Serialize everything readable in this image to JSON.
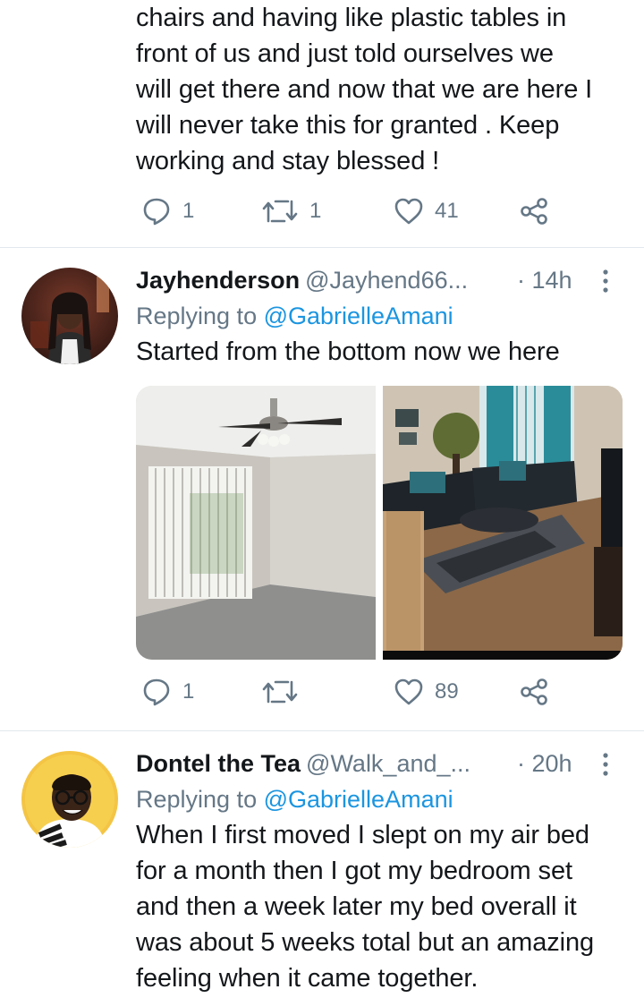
{
  "top_tweet": {
    "text_lines": [
      "chairs and having like plastic tables in",
      "front of us and just told ourselves we",
      "will get there and now that we are here I",
      "will never take this for granted . Keep",
      "working and stay blessed !"
    ],
    "replies": "1",
    "retweets": "1",
    "likes": "41"
  },
  "reply1": {
    "name": "Jayhenderson",
    "handle": "@Jayhend66...",
    "time": "· 14h",
    "replying_prefix": "Replying to",
    "replying_to": "@GabrielleAmani",
    "text": "Started from the bottom now we here",
    "replies": "1",
    "retweets": "",
    "likes": "89"
  },
  "reply2": {
    "name": "Dontel the Tea",
    "handle": "@Walk_and_...",
    "time": "· 20h",
    "replying_prefix": "Replying to",
    "replying_to": "@GabrielleAmani",
    "text_lines": [
      "When I first moved I slept on my air bed",
      "for a month then I got my bedroom set",
      "and then a week later my bed overall it",
      "was about 5 weeks total but an amazing",
      "feeling when it came together."
    ]
  },
  "colors": {
    "icon_gray": "#657786",
    "link_blue": "#1b95e0",
    "divider": "#e1e8ed"
  },
  "icons": [
    "reply-icon",
    "retweet-icon",
    "like-icon",
    "share-icon",
    "more-icon"
  ]
}
